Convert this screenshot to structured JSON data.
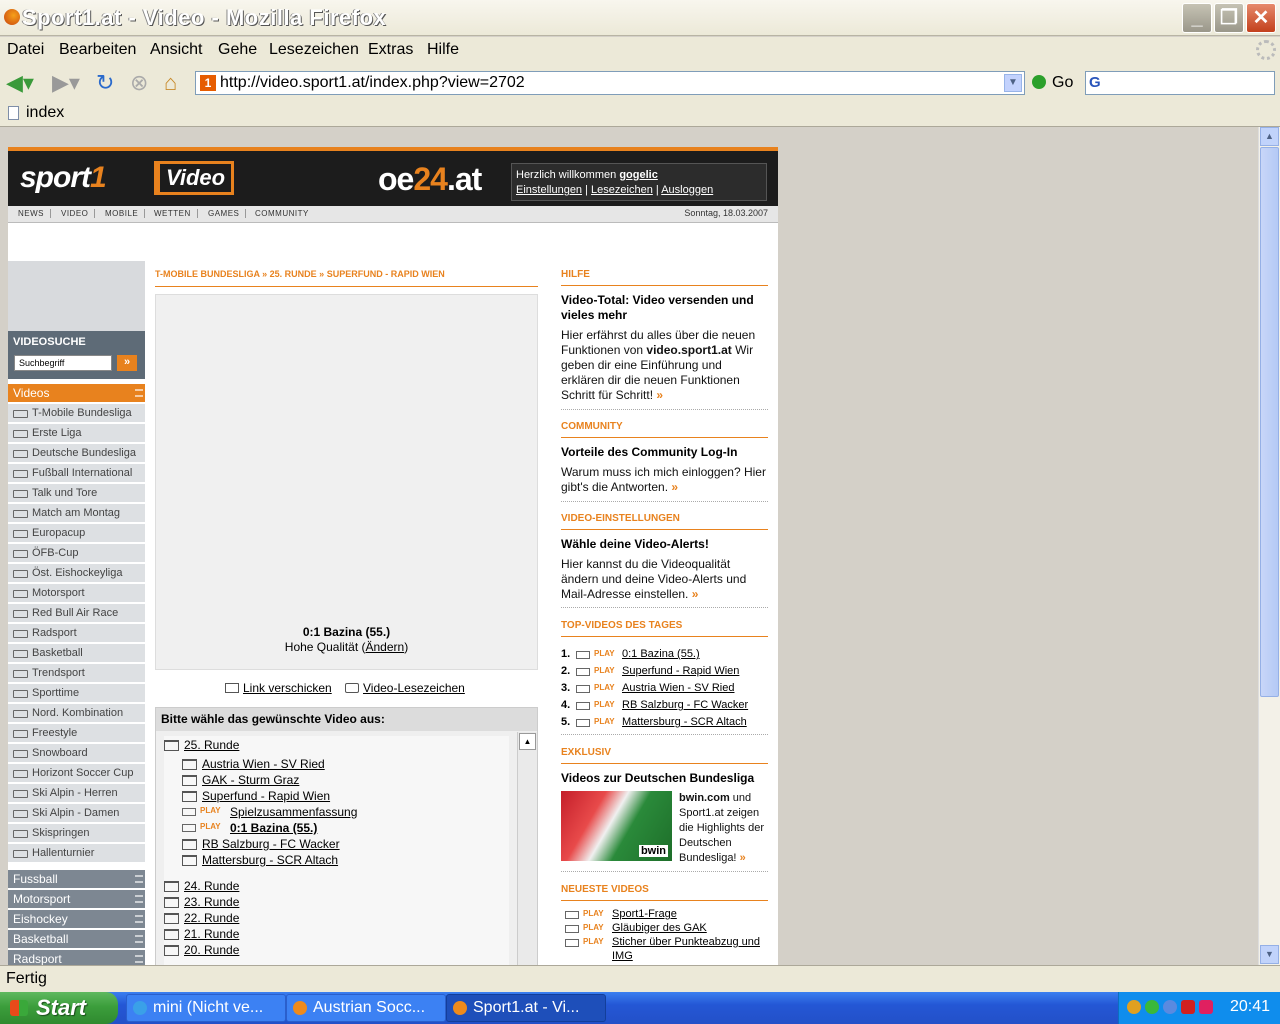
{
  "window": {
    "title": "Sport1.at - Video - Mozilla Firefox",
    "menu": [
      "Datei",
      "Bearbeiten",
      "Ansicht",
      "Gehe",
      "Lesezeichen",
      "Extras",
      "Hilfe"
    ],
    "url": "http://video.sport1.at/index.php?view=2702",
    "go_label": "Go",
    "tab_label": "index",
    "status": "Fertig"
  },
  "taskbar": {
    "start": "Start",
    "items": [
      "mini (Nicht ve...",
      "Austrian Socc...",
      "Sport1.at - Vi..."
    ],
    "clock": "20:41"
  },
  "site": {
    "logo_sport": "sport",
    "logo_one": "1",
    "logo_video": "Video",
    "logo_oe": "oe",
    "logo_24": "24",
    "logo_at": ".at",
    "welcome_text": "Herzlich willkommen",
    "username": "gogelic",
    "links": [
      "Einstellungen",
      "Lesezeichen",
      "Ausloggen"
    ],
    "tabs": [
      "NEWS",
      "VIDEO",
      "MOBILE",
      "WETTEN",
      "GAMES",
      "COMMUNITY"
    ],
    "date": "Sonntag, 18.03.2007"
  },
  "leftnav": {
    "search_title": "VIDEOSUCHE",
    "search_placeholder": "Suchbegriff",
    "search_go": "»",
    "videos_label": "Videos",
    "items": [
      "T-Mobile Bundesliga",
      "Erste Liga",
      "Deutsche Bundesliga",
      "Fußball International",
      "Talk und Tore",
      "Match am Montag",
      "Europacup",
      "ÖFB-Cup",
      "Öst. Eishockeyliga",
      "Motorsport",
      "Red Bull Air Race",
      "Radsport",
      "Basketball",
      "Trendsport",
      "Sporttime",
      "Nord. Kombination",
      "Freestyle",
      "Snowboard",
      "Horizont Soccer Cup",
      "Ski Alpin - Herren",
      "Ski Alpin - Damen",
      "Skispringen",
      "Hallenturnier"
    ],
    "sections": [
      "Fussball",
      "Motorsport",
      "Eishockey",
      "Basketball",
      "Radsport"
    ]
  },
  "center": {
    "breadcrumb": "T-MOBILE BUNDESLIGA » 25. RUNDE » SUPERFUND - RAPID WIEN",
    "video_title": "0:1 Bazina (55.)",
    "quality_text": "Hohe Qualität (",
    "quality_link": "Ändern",
    "quality_end": ")",
    "link_send": "Link verschicken",
    "bookmark": "Video-Lesezeichen",
    "pick_title": "Bitte wähle das gewünschte Video aus:",
    "round_open": "25. Runde",
    "games": [
      "Austria Wien - SV Ried",
      "GAK - Sturm Graz",
      "Superfund - Rapid Wien"
    ],
    "play_label": "PLAY",
    "sub_items": [
      "Spielzusammenfassung",
      "0:1 Bazina (55.)"
    ],
    "games_after": [
      "RB Salzburg - FC Wacker",
      "Mattersburg - SCR Altach"
    ],
    "rounds": [
      "24. Runde",
      "23. Runde",
      "22. Runde",
      "21. Runde",
      "20. Runde"
    ]
  },
  "right": {
    "hilfe": {
      "head": "HILFE",
      "title": "Video-Total: Video versenden und vieles mehr",
      "text1": "Hier erfährst du alles über die neuen Funktionen von ",
      "bold": "video.sport1.at",
      "text2": " Wir geben dir eine Einführung und erklären dir die neuen Funktionen Schritt für Schritt!",
      "more": "»"
    },
    "community": {
      "head": "COMMUNITY",
      "title": "Vorteile des Community Log-In",
      "text": "Warum muss ich mich einloggen? Hier gibt's die Antworten.",
      "more": "»"
    },
    "einst": {
      "head": "VIDEO-EINSTELLUNGEN",
      "title": "Wähle deine Video-Alerts!",
      "text": "Hier kannst du die Videoqualität ändern und deine Video-Alerts und Mail-Adresse einstellen.",
      "more": "»"
    },
    "top": {
      "head": "TOP-VIDEOS DES TAGES",
      "play": "PLAY",
      "nums": [
        "1.",
        "2.",
        "3.",
        "4.",
        "5."
      ],
      "items": [
        "0:1 Bazina (55.)",
        "Superfund - Rapid Wien",
        "Austria Wien - SV Ried",
        "RB Salzburg - FC Wacker",
        "Mattersburg - SCR Altach"
      ]
    },
    "exklusiv": {
      "head": "EXKLUSIV",
      "title": "Videos zur Deutschen Bundesliga",
      "bold": "bwin.com",
      "text": " und Sport1.at zeigen die Highlights der Deutschen Bundesliga!",
      "more": "»",
      "img_logo": "bwin"
    },
    "neueste": {
      "head": "NEUESTE VIDEOS",
      "play": "PLAY",
      "items": [
        "Sport1-Frage",
        "Gläubiger des GAK",
        "Sticher über Punkteabzug und",
        "IMG"
      ]
    }
  }
}
